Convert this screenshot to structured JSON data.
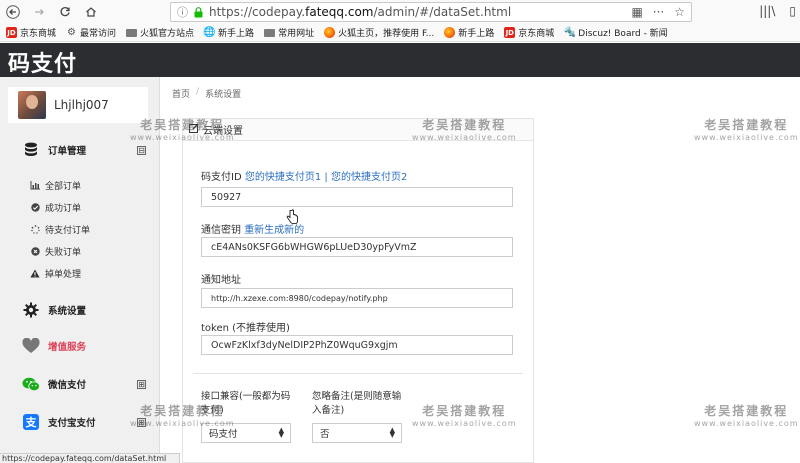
{
  "browser": {
    "url_prefix": "https://codepay.",
    "url_domain": "fateqq.com",
    "url_path": "/admin/#/dataSet.html"
  },
  "bookmarks": [
    {
      "label": "京东商城",
      "icon": "jd-icon"
    },
    {
      "label": "最常访问",
      "icon": "gear-icon"
    },
    {
      "label": "火狐官方站点",
      "icon": "folder-icon"
    },
    {
      "label": "新手上路",
      "icon": "globe-icon"
    },
    {
      "label": "常用网址",
      "icon": "folder-icon"
    },
    {
      "label": "火狐主页，推荐使用 F...",
      "icon": "firefox-icon"
    },
    {
      "label": "新手上路",
      "icon": "firefox-icon"
    },
    {
      "label": "京东商城",
      "icon": "jd-icon"
    },
    {
      "label": "Discuz! Board - 新闻",
      "icon": "discuz-icon"
    }
  ],
  "app": {
    "brand": "码支付"
  },
  "user": {
    "name": "Lhjlhj007"
  },
  "sidebar": {
    "order_group": "订单管理",
    "order_items": [
      {
        "label": "全部订单",
        "icon": "chart-icon"
      },
      {
        "label": "成功订单",
        "icon": "check-circle-icon"
      },
      {
        "label": "待支付订单",
        "icon": "spinner-icon"
      },
      {
        "label": "失败订单",
        "icon": "x-circle-icon"
      },
      {
        "label": "掉单处理",
        "icon": "warning-icon"
      }
    ],
    "settings": "系统设置",
    "value_added": "增值服务",
    "wechat": "微信支付",
    "alipay": "支付宝支付",
    "collapse_symbol": "⊟",
    "expand_symbol": "⊞"
  },
  "breadcrumb": {
    "home": "首页",
    "current": "系统设置"
  },
  "panel": {
    "title": "云端设置"
  },
  "form": {
    "code_id_label": "码支付ID",
    "quick_page_1": "您的快捷支付页1",
    "separator": "|",
    "quick_page_2": "您的快捷支付页2",
    "code_id_value": "50927",
    "secret_label": "通信密钥",
    "regenerate_link": "重新生成新的",
    "secret_value": "cE4ANs0KSFG6bWHGW6pLUeD30ypFyVmZ",
    "notify_label": "通知地址",
    "notify_value": "http://h.xzexe.com:8980/codepay/notify.php",
    "token_label": "token (不推荐使用)",
    "token_value": "OcwFzKlxf3dyNelDIP2PhZ0WquG9xgjm",
    "compat_label": "接口兼容(一般都为码支付)",
    "compat_value": "码支付",
    "ignore_label": "忽略备注(是则随意输入备注)",
    "ignore_value": "否"
  },
  "status_bar": {
    "url": "https://codepay.fateqq.com/dataSet.html"
  },
  "watermark": {
    "cn": "老吴搭建教程",
    "en": "www.weixiaolive.com"
  },
  "colors": {
    "header": "#2b2d31",
    "link": "#2c6fbf",
    "heart": "#e0455a",
    "wechat": "#1aad19",
    "alipay": "#1677ff"
  }
}
